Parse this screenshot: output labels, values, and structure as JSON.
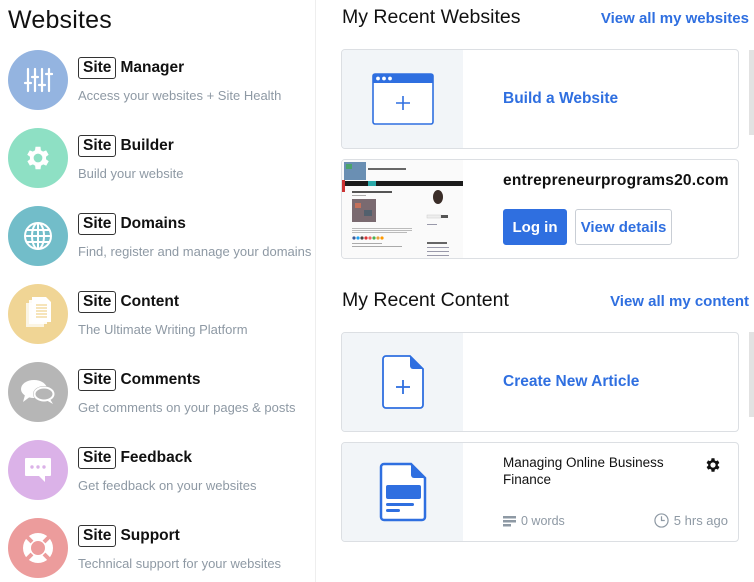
{
  "left": {
    "heading": "Websites",
    "tools": [
      {
        "badge": "Site",
        "name": "Manager",
        "desc": "Access your websites + Site Health",
        "icon": "sliders-icon",
        "color": "#94b4e0"
      },
      {
        "badge": "Site",
        "name": "Builder",
        "desc": "Build your website",
        "icon": "gear-icon",
        "color": "#8ee0c4"
      },
      {
        "badge": "Site",
        "name": "Domains",
        "desc": "Find, register and manage your domains",
        "icon": "globe-icon",
        "color": "#72bdc9"
      },
      {
        "badge": "Site",
        "name": "Content",
        "desc": "The Ultimate Writing Platform",
        "icon": "documents-icon",
        "color": "#f0d595"
      },
      {
        "badge": "Site",
        "name": "Comments",
        "desc": "Get comments on your pages & posts",
        "icon": "chat-bubbles-icon",
        "color": "#b6b6b6"
      },
      {
        "badge": "Site",
        "name": "Feedback",
        "desc": "Get feedback on your websites",
        "icon": "feedback-bubble-icon",
        "color": "#dbb2e8"
      },
      {
        "badge": "Site",
        "name": "Support",
        "desc": "Technical support for your websites",
        "icon": "lifebuoy-icon",
        "color": "#ec9c9c"
      }
    ]
  },
  "websites": {
    "title": "My Recent Websites",
    "view_all": "View all my websites",
    "build_label": "Build a Website",
    "site": {
      "domain": "entrepreneurprograms20.com",
      "login_label": "Log in",
      "details_label": "View details"
    }
  },
  "content": {
    "title": "My Recent Content",
    "view_all": "View all my content",
    "create_label": "Create New Article",
    "article": {
      "title": "Managing Online Business Finance",
      "words": "0 words",
      "updated": "5 hrs ago"
    }
  },
  "colors": {
    "accent": "#2f6fe0",
    "muted_text": "#8e99a4"
  }
}
